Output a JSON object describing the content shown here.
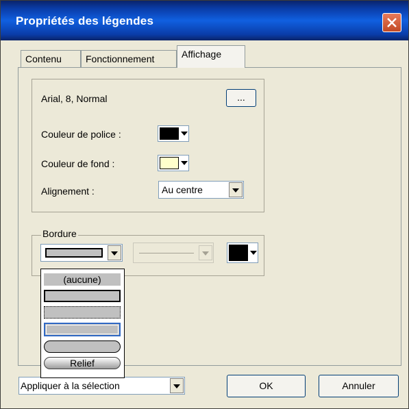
{
  "window": {
    "title": "Propriétés des légendes"
  },
  "tabs": [
    {
      "label": "Contenu",
      "active": false
    },
    {
      "label": "Fonctionnement",
      "active": false
    },
    {
      "label": "Affichage",
      "active": true
    }
  ],
  "font": {
    "description": "Arial, 8, Normal",
    "button_label": "..."
  },
  "font_color": {
    "label": "Couleur de police :",
    "value": "#000000"
  },
  "background_color": {
    "label": "Couleur de fond :",
    "value": "#ffffcc"
  },
  "alignment": {
    "label": "Alignement :",
    "value": "Au centre"
  },
  "border": {
    "group_label": "Bordure",
    "style_options": [
      {
        "label": "(aucune)"
      },
      {
        "label": ""
      },
      {
        "label": ""
      },
      {
        "label": ""
      },
      {
        "label": ""
      },
      {
        "label": "Relief"
      }
    ],
    "color": "#000000"
  },
  "footer": {
    "apply_combo": "Appliquer à la sélection",
    "ok_label": "OK",
    "cancel_label": "Annuler"
  }
}
